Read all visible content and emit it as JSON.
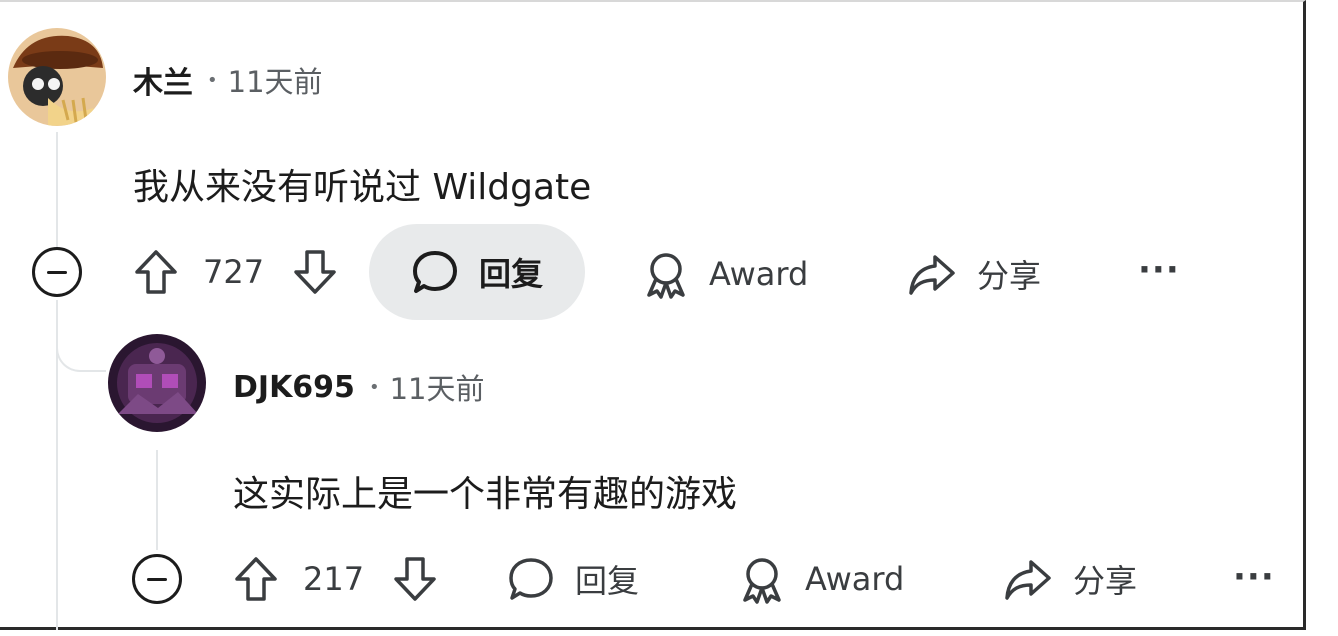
{
  "comments": [
    {
      "author": "木兰",
      "separator": "•",
      "time": "11天前",
      "body": "我从来没有听说过 Wildgate",
      "votes": "727",
      "reply_label": "回复",
      "award_label": "Award",
      "share_label": "分享",
      "more_label": "···"
    },
    {
      "author": "DJK695",
      "separator": "•",
      "time": "11天前",
      "body": "这实际上是一个非常有趣的游戏",
      "votes": "217",
      "reply_label": "回复",
      "award_label": "Award",
      "share_label": "分享",
      "more_label": "···"
    }
  ],
  "icons": {
    "upvote": "upvote-arrow-icon",
    "downvote": "downvote-arrow-icon",
    "reply": "speech-bubble-icon",
    "award": "award-ribbon-icon",
    "share": "share-arrow-icon",
    "collapse": "collapse-minus-icon"
  }
}
